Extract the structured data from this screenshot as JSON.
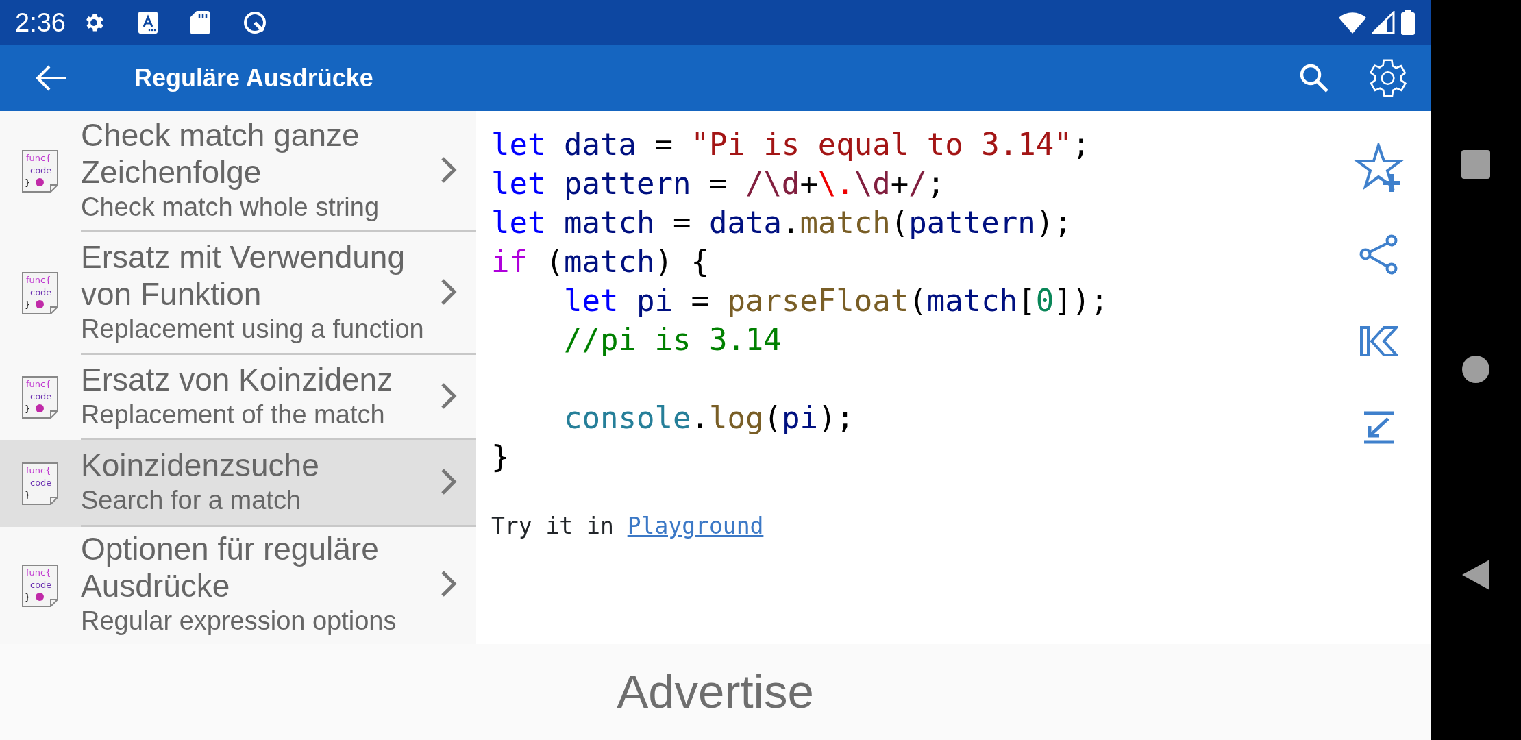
{
  "status_bar": {
    "time": "2:36"
  },
  "app_bar": {
    "title": "Reguläre Ausdrücke"
  },
  "list": [
    {
      "title": "Check match ganze Zeichenfolge",
      "subtitle": "Check match whole string",
      "icon_text": [
        "func{",
        "code",
        "}"
      ],
      "dot": true,
      "selected": false
    },
    {
      "title": "Ersatz mit Verwendung von Funktion",
      "subtitle": "Replacement using a function",
      "icon_text": [
        "func{",
        "code",
        "}"
      ],
      "dot": true,
      "selected": false
    },
    {
      "title": "Ersatz von Koinzidenz",
      "subtitle": "Replacement of the match",
      "icon_text": [
        "func{",
        "code",
        "}"
      ],
      "dot": true,
      "selected": false
    },
    {
      "title": "Koinzidenzsuche",
      "subtitle": "Search for a match",
      "icon_text": [
        "func{",
        "code",
        "}"
      ],
      "dot": false,
      "selected": true
    },
    {
      "title": "Optionen für reguläre Ausdrücke",
      "subtitle": "Regular expression options",
      "icon_text": [
        "func{",
        "code",
        "}"
      ],
      "dot": true,
      "selected": false
    }
  ],
  "code": {
    "lines": [
      {
        "kind": "code",
        "tokens": [
          {
            "kind": "keyword",
            "text": "let"
          },
          {
            "kind": "variable",
            "text": " data"
          },
          {
            "kind": "plain",
            "text": " = "
          },
          {
            "kind": "string",
            "text": "\"Pi is equal to 3.14\""
          },
          {
            "kind": "plain",
            "text": ";"
          }
        ]
      },
      {
        "kind": "code",
        "tokens": [
          {
            "kind": "keyword",
            "text": "let"
          },
          {
            "kind": "variable",
            "text": " pattern"
          },
          {
            "kind": "plain",
            "text": " = "
          },
          {
            "kind": "regex",
            "text": "/\\d"
          },
          {
            "kind": "plain",
            "text": "+"
          },
          {
            "kind": "escape",
            "text": "\\."
          },
          {
            "kind": "regex",
            "text": "\\d"
          },
          {
            "kind": "plain",
            "text": "+"
          },
          {
            "kind": "regex",
            "text": "/"
          },
          {
            "kind": "plain",
            "text": ";"
          }
        ]
      },
      {
        "kind": "code",
        "tokens": [
          {
            "kind": "keyword",
            "text": "let"
          },
          {
            "kind": "variable",
            "text": " match"
          },
          {
            "kind": "plain",
            "text": " = "
          },
          {
            "kind": "variable",
            "text": "data"
          },
          {
            "kind": "plain",
            "text": "."
          },
          {
            "kind": "function",
            "text": "match"
          },
          {
            "kind": "plain",
            "text": "("
          },
          {
            "kind": "variable",
            "text": "pattern"
          },
          {
            "kind": "plain",
            "text": ");"
          }
        ]
      },
      {
        "kind": "code",
        "tokens": [
          {
            "kind": "control",
            "text": "if"
          },
          {
            "kind": "plain",
            "text": " ("
          },
          {
            "kind": "variable",
            "text": "match"
          },
          {
            "kind": "plain",
            "text": ") {"
          }
        ]
      },
      {
        "kind": "code",
        "tokens": [
          {
            "kind": "keyword",
            "text": "    let"
          },
          {
            "kind": "variable",
            "text": " pi"
          },
          {
            "kind": "plain",
            "text": " = "
          },
          {
            "kind": "function",
            "text": "parseFloat"
          },
          {
            "kind": "plain",
            "text": "("
          },
          {
            "kind": "variable",
            "text": "match"
          },
          {
            "kind": "plain",
            "text": "["
          },
          {
            "kind": "number",
            "text": "0"
          },
          {
            "kind": "plain",
            "text": "]);"
          }
        ]
      },
      {
        "kind": "code",
        "tokens": [
          {
            "kind": "comment",
            "text": "    //pi is 3.14"
          }
        ]
      },
      {
        "kind": "blank"
      },
      {
        "kind": "code",
        "tokens": [
          {
            "kind": "class",
            "text": "    console"
          },
          {
            "kind": "plain",
            "text": "."
          },
          {
            "kind": "function",
            "text": "log"
          },
          {
            "kind": "plain",
            "text": "("
          },
          {
            "kind": "variable",
            "text": "pi"
          },
          {
            "kind": "plain",
            "text": ");"
          }
        ]
      },
      {
        "kind": "code",
        "tokens": [
          {
            "kind": "plain",
            "text": "}"
          }
        ]
      }
    ]
  },
  "try_it": {
    "text": "Try it in",
    "link": "Playground"
  },
  "ad": {
    "text": "Advertise"
  }
}
